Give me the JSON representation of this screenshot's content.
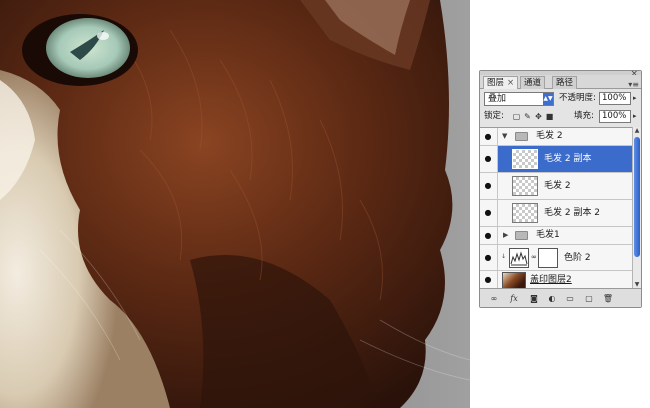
{
  "panel": {
    "tabs": [
      {
        "label": "图层",
        "active": true,
        "close": "×"
      },
      {
        "label": "通道",
        "active": false
      },
      {
        "label": "路径",
        "active": false
      }
    ],
    "close_glyph": "×",
    "menu_glyph": "▾≡",
    "blend_mode": "叠加",
    "opacity_label": "不透明度:",
    "opacity_value": "100%",
    "lock_label": "锁定:",
    "fill_label": "填充:",
    "fill_value": "100%"
  },
  "layers": [
    {
      "name": "毛发 2",
      "kind": "group",
      "expanded": true
    },
    {
      "name": "毛发 2 副本",
      "kind": "layer",
      "selected": true
    },
    {
      "name": "毛发 2",
      "kind": "layer"
    },
    {
      "name": "毛发 2 副本 2",
      "kind": "layer"
    },
    {
      "name": "毛发1",
      "kind": "group",
      "expanded": false
    },
    {
      "name": "色阶 2",
      "kind": "adjustment"
    },
    {
      "name": "盖印图层2",
      "kind": "image"
    }
  ],
  "colors": {
    "selection": "#3b6bcb",
    "fur_dark": "#3b1a0e",
    "fur_mid": "#7a3a1e",
    "fur_light": "#e8dcc8",
    "background_gray": "#8a8a8a"
  }
}
